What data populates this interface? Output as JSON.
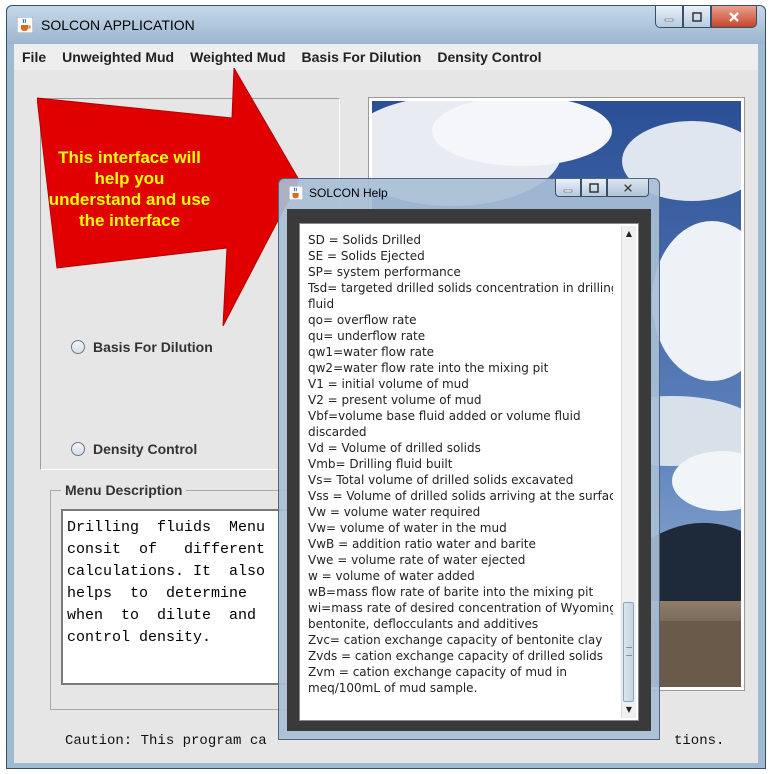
{
  "main_window": {
    "title": "SOLCON APPLICATION",
    "icon": "java-cup-icon"
  },
  "menubar": [
    "File",
    "Unweighted Mud",
    "Weighted Mud",
    "Basis For Dilution",
    "Density Control"
  ],
  "radio_options": [
    {
      "label": "Basis For Dilution",
      "selected": false
    },
    {
      "label": "Density Control",
      "selected": false
    }
  ],
  "menu_description": {
    "title": "Menu Description",
    "text": "Drilling  fluids  Menu\nconsit  of   different\ncalculations. It  also\nhelps  to  determine\nwhen  to  dilute  and\ncontrol density."
  },
  "caution": {
    "visible_start": "Caution: This program ca",
    "visible_end": "tions."
  },
  "callout": {
    "text": "This interface will help you understand and use the interface",
    "arrow_color": "#e00000",
    "text_color": "#ffff00"
  },
  "help_window": {
    "title": "SOLCON Help",
    "lines": [
      "SD = Solids Drilled",
      "SE = Solids Ejected",
      "SP= system performance",
      "Tsd= targeted drilled solids concentration in drilling",
      " fluid",
      "qo= overflow rate",
      "qu= underflow rate",
      "qw1=water flow rate",
      "qw2=water flow rate into the mixing pit",
      "V1 = initial volume of mud",
      "V2 = present volume of mud",
      "Vbf=volume base fluid added or volume fluid",
      " discarded",
      "Vd = Volume of drilled solids",
      "Vmb= Drilling fluid built",
      "Vs= Total volume of drilled solids excavated",
      "Vss = Volume of drilled solids arriving at the surface",
      "Vw = volume water required",
      "Vw= volume of water in the mud",
      "VwB = addition ratio water and barite",
      "Vwe = volume rate of water ejected",
      "w = volume of water added",
      "wB=mass flow rate of barite into the mixing pit",
      "wi=mass rate of desired concentration of Wyoming",
      " bentonite, deflocculants and additives",
      "Zvc=  cation exchange capacity of bentonite clay",
      "Zvds = cation exchange capacity of drilled solids",
      "Zvm = cation exchange capacity of mud in",
      " meq/100mL of mud sample."
    ],
    "scroll_position": 0.78
  }
}
